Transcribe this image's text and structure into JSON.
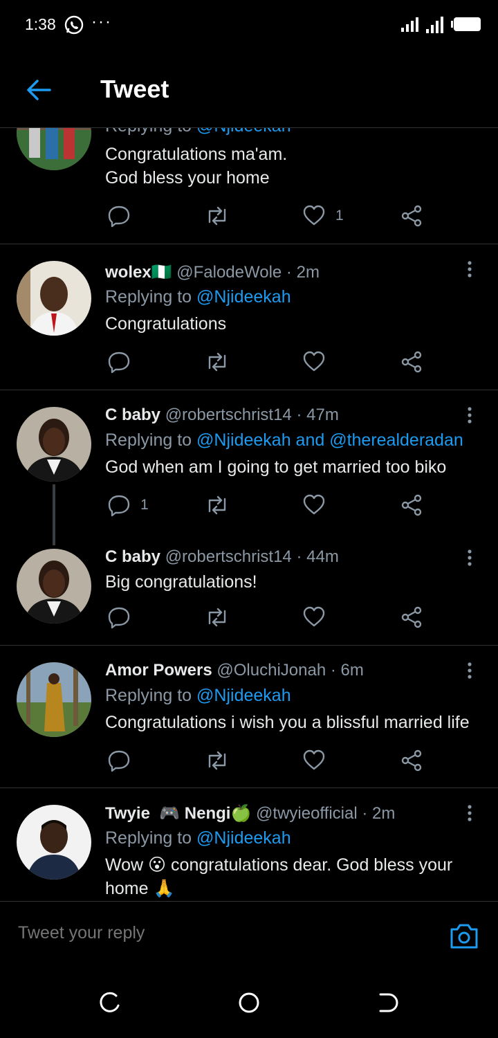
{
  "status": {
    "time": "1:38",
    "dots": "···"
  },
  "header": {
    "title": "Tweet"
  },
  "replies": [
    {
      "replying_prefix": "Replying to",
      "replying_to": "@Njideekah",
      "text": "Congratulations ma'am.\nGod bless your home",
      "likes": "1"
    },
    {
      "name": "wolex🇳🇬",
      "handle": "@FalodeWole",
      "time": "2m",
      "replying_prefix": "Replying to",
      "replying_to": "@Njideekah",
      "text": "Congratulations"
    },
    {
      "name": "C baby",
      "handle": "@robertschrist14",
      "time": "47m",
      "replying_prefix": "Replying to",
      "replying_to": "@Njideekah and @therealderadan",
      "text": "God when am I going to get married too biko",
      "replies": "1"
    },
    {
      "name": "C baby",
      "handle": "@robertschrist14",
      "time": "44m",
      "text": "Big congratulations!"
    },
    {
      "name": "Amor Powers",
      "handle": "@OluchiJonah",
      "time": "6m",
      "replying_prefix": "Replying to",
      "replying_to": "@Njideekah",
      "text": "Congratulations i wish you a blissful married life"
    },
    {
      "name": "Twyie ⁣ 🎮 Nengi🍏",
      "handle": "@twyieofficial",
      "time": "2m",
      "replying_prefix": "Replying to",
      "replying_to": "@Njideekah",
      "text": "Wow 😮 congratulations dear. God bless your home 🙏"
    }
  ],
  "composer": {
    "placeholder": "Tweet your reply"
  },
  "colors": {
    "accent": "#1d9bf0",
    "muted": "#8b98a5",
    "background": "#000000"
  }
}
